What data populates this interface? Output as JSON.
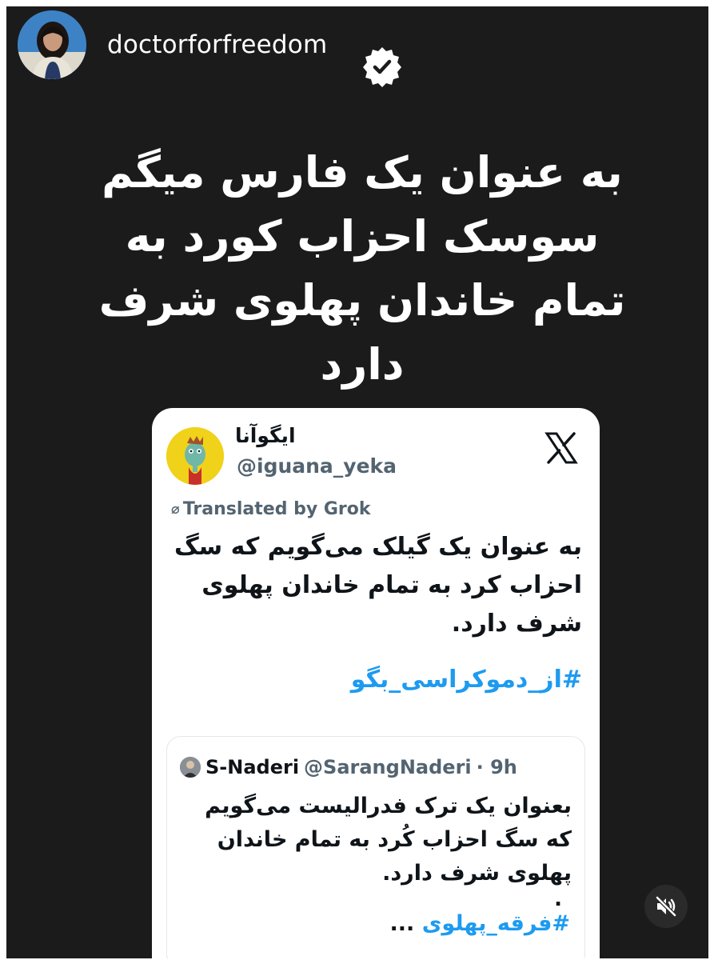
{
  "story": {
    "username": "doctorforfreedom",
    "verified_icon": "verified-badge-icon",
    "headline_lines": [
      "به عنوان یک فارس میگم",
      "سوسک احزاب کورد به",
      "تمام خاندان پهلوی شرف",
      "دارد"
    ],
    "mute_icon": "sound-off-icon"
  },
  "tweet": {
    "display_name": "ایگوآنا",
    "handle": "@iguana_yeka",
    "platform_icon": "x-logo-icon",
    "translated_label": "Translated by Grok",
    "text_lines": [
      "به عنوان یک گیلک می‌گویم که سگ",
      "احزاب کرد به تمام خاندان پهلوی",
      "شرف دارد."
    ],
    "hashtag": "#از_دموکراسی_بگو",
    "quote": {
      "name": "S-Naderi",
      "handle": "@SarangNaderi",
      "time": "· 9h",
      "text_lines": [
        "بعنوان یک ترک فدرالیست می‌گویم",
        "که سگ احزاب کُرد به تمام خاندان",
        "پهلوی شرف دارد."
      ],
      "dot": ".",
      "hashtag": "#فرقه_پهلوی",
      "ellipsis": "..."
    }
  },
  "colors": {
    "story_background": "#1b1b1b",
    "link_blue": "#1d9bf0",
    "secondary_text": "#536471"
  }
}
